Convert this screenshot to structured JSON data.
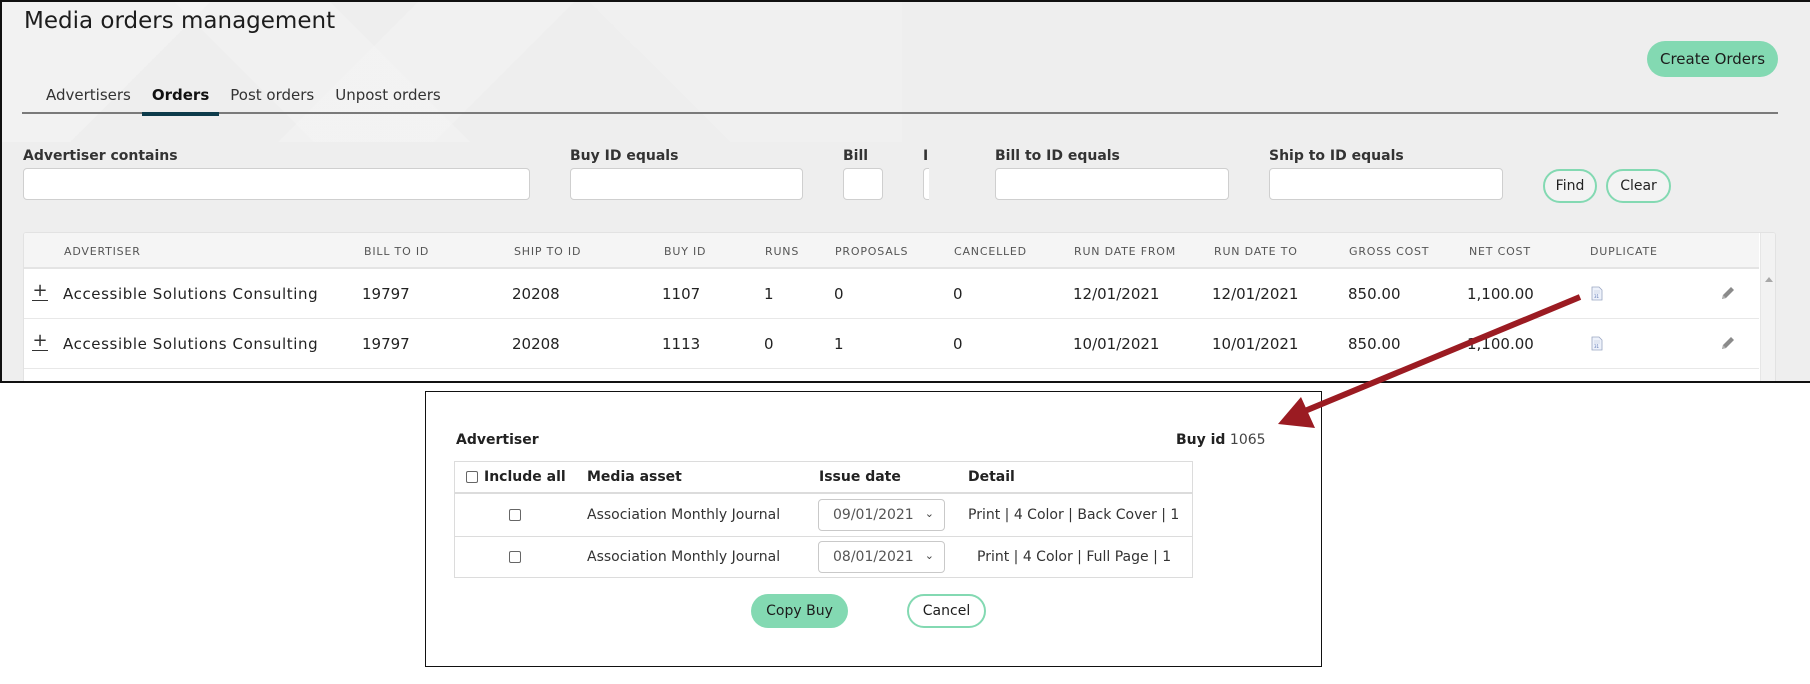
{
  "page": {
    "title": "Media orders management",
    "create_orders_label": "Create Orders"
  },
  "tabs": [
    {
      "label": "Advertisers",
      "active": false
    },
    {
      "label": "Orders",
      "active": true
    },
    {
      "label": "Post orders",
      "active": false
    },
    {
      "label": "Unpost orders",
      "active": false
    }
  ],
  "filters": {
    "advertiser_contains": {
      "label": "Advertiser contains",
      "value": ""
    },
    "buy_id_equals": {
      "label": "Buy ID equals",
      "value": ""
    },
    "bill_truncated": {
      "label": "Bill t",
      "value": ""
    },
    "hidden_truncated": {
      "label": "I",
      "value": ""
    },
    "bill_to_id_equals": {
      "label": "Bill to ID equals",
      "value": ""
    },
    "ship_to_id_equals": {
      "label": "Ship to ID equals",
      "value": ""
    },
    "find_label": "Find",
    "clear_label": "Clear"
  },
  "orders_table": {
    "columns": [
      "ADVERTISER",
      "BILL TO ID",
      "SHIP TO ID",
      "BUY ID",
      "RUNS",
      "PROPOSALS",
      "CANCELLED",
      "RUN DATE FROM",
      "RUN DATE TO",
      "GROSS COST",
      "NET COST",
      "DUPLICATE"
    ],
    "rows": [
      {
        "expand": "+",
        "advertiser": "Accessible Solutions Consulting",
        "bill_to_id": "19797",
        "ship_to_id": "20208",
        "buy_id": "1107",
        "runs": "1",
        "proposals": "0",
        "cancelled": "0",
        "run_date_from": "12/01/2021",
        "run_date_to": "12/01/2021",
        "gross_cost": "850.00",
        "net_cost": "1,100.00"
      },
      {
        "expand": "+",
        "advertiser": "Accessible Solutions Consulting",
        "bill_to_id": "19797",
        "ship_to_id": "20208",
        "buy_id": "1113",
        "runs": "0",
        "proposals": "1",
        "cancelled": "0",
        "run_date_from": "10/01/2021",
        "run_date_to": "10/01/2021",
        "gross_cost": "850.00",
        "net_cost": "1,100.00"
      }
    ]
  },
  "duplicate_dialog": {
    "advertiser_label": "Advertiser",
    "buy_id_label": "Buy id",
    "buy_id_value": "1065",
    "columns": {
      "include_all": "Include all",
      "media_asset": "Media asset",
      "issue_date": "Issue date",
      "detail": "Detail"
    },
    "rows": [
      {
        "checked": false,
        "media_asset": "Association Monthly Journal",
        "issue_date": "09/01/2021",
        "detail": "Print | 4 Color | Back Cover | 1"
      },
      {
        "checked": false,
        "media_asset": "Association Monthly Journal",
        "issue_date": "08/01/2021",
        "detail": "Print | 4 Color | Full Page | 1"
      }
    ],
    "copy_buy_label": "Copy Buy",
    "cancel_label": "Cancel"
  },
  "colors": {
    "accent_green": "#83d9b2",
    "active_tab": "#0d3b4b",
    "annotation_arrow": "#9b1b22"
  }
}
